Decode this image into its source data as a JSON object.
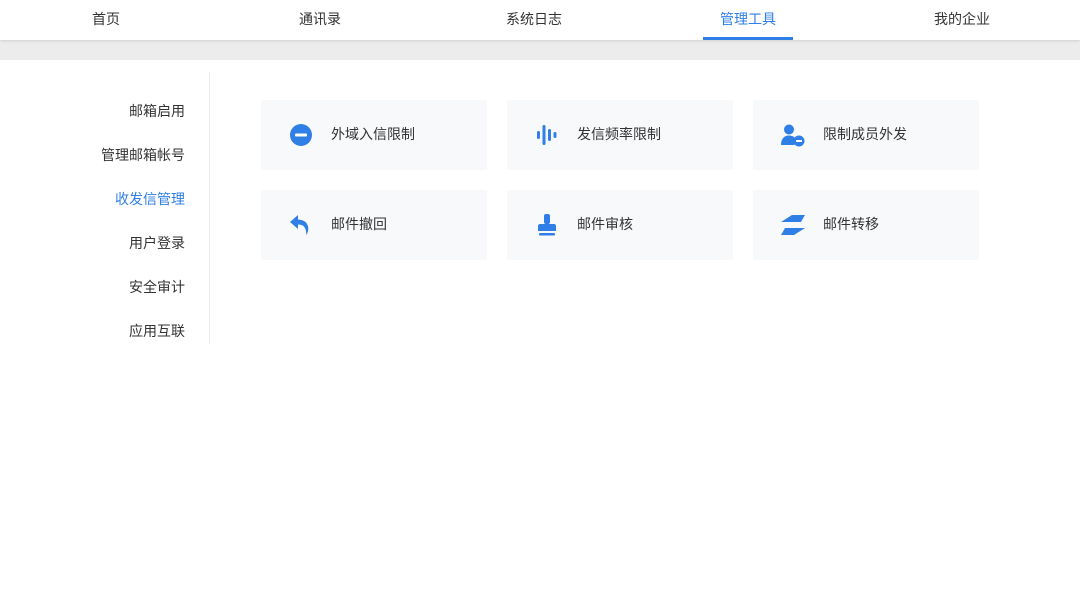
{
  "colors": {
    "accent": "#2f7fe6",
    "text": "#333333",
    "card_bg": "#f7f9fb"
  },
  "topnav": {
    "items": [
      {
        "label": "首页"
      },
      {
        "label": "通讯录"
      },
      {
        "label": "系统日志"
      },
      {
        "label": "管理工具",
        "active": true
      },
      {
        "label": "我的企业"
      }
    ]
  },
  "sidebar": {
    "items": [
      {
        "label": "邮箱启用"
      },
      {
        "label": "管理邮箱帐号"
      },
      {
        "label": "收发信管理",
        "active": true
      },
      {
        "label": "用户登录"
      },
      {
        "label": "安全审计"
      },
      {
        "label": "应用互联"
      }
    ]
  },
  "tools": [
    {
      "label": "外域入信限制",
      "icon": "minus-circle-icon"
    },
    {
      "label": "发信频率限制",
      "icon": "frequency-bars-icon"
    },
    {
      "label": "限制成员外发",
      "icon": "user-restrict-icon"
    },
    {
      "label": "邮件撤回",
      "icon": "undo-arrow-icon"
    },
    {
      "label": "邮件审核",
      "icon": "stamp-icon"
    },
    {
      "label": "邮件转移",
      "icon": "transfer-arrows-icon"
    }
  ]
}
